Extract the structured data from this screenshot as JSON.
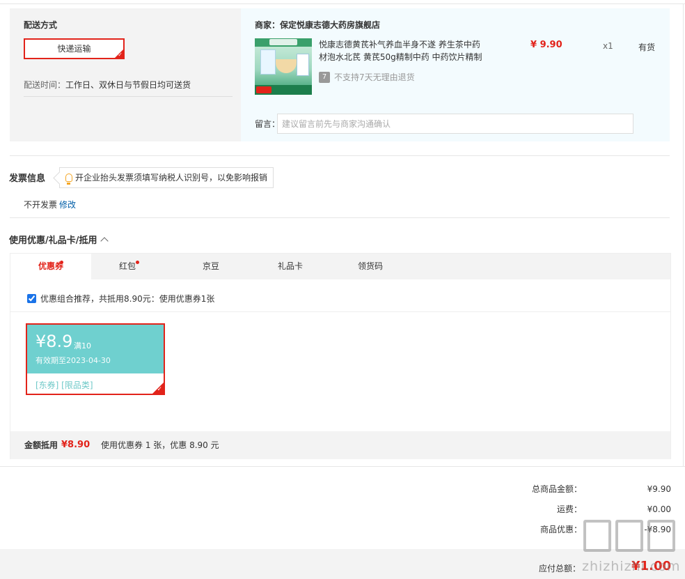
{
  "shipping": {
    "title": "配送方式",
    "method": "快递运输",
    "time_label": "配送时间：",
    "time_value": "工作日、双休日与节假日均可送货"
  },
  "seller": {
    "label": "商家：保定悦康志德大药房旗舰店",
    "product": {
      "name": "悦康志德黄芪补气养血半身不遂 养生茶中药材泡水北芪 黄芪50g精制中药 中药饮片精制",
      "price": "¥ 9.90",
      "qty": "x1",
      "stock": "有货",
      "return_policy": "不支持7天无理由退货",
      "return_icon_text": "7"
    },
    "remark_label": "留言：",
    "remark_placeholder": "建议留言前先与商家沟通确认"
  },
  "invoice": {
    "title": "发票信息",
    "tip": "开企业抬头发票须填写纳税人识别号，以免影响报销",
    "status": "不开发票",
    "edit": "修改"
  },
  "coupons": {
    "title": "使用优惠/礼品卡/抵用",
    "tabs": [
      {
        "label": "优惠券",
        "active": true,
        "dot": true
      },
      {
        "label": "红包",
        "active": false,
        "dot": true
      },
      {
        "label": "京豆",
        "active": false,
        "dot": false
      },
      {
        "label": "礼品卡",
        "active": false,
        "dot": false
      },
      {
        "label": "领货码",
        "active": false,
        "dot": false
      }
    ],
    "combo_text": "优惠组合推荐，共抵用8.90元：使用优惠券1张",
    "combo_checked": true,
    "card": {
      "amount": "¥8.9",
      "condition": "满10",
      "expiry": "有效期至2023-04-30",
      "tags": "[东券]  [限品类]",
      "color": "#6fd0cf"
    },
    "summary_label": "金额抵用",
    "summary_value": "¥8.90",
    "summary_desc": "使用优惠券 1 张，优惠 8.90 元"
  },
  "totals": {
    "goods_label": "总商品金额：",
    "goods_value": "¥9.90",
    "freight_label": "运费：",
    "freight_value": "¥0.00",
    "discount_label": "商品优惠：",
    "discount_value": "-¥8.90",
    "pay_label": "应付总额：",
    "pay_value": "¥1.00"
  },
  "watermark": {
    "text": "zhizhizhi.com"
  },
  "colors": {
    "accent": "#e2231a",
    "link": "#005ea7",
    "coupon": "#6fd0cf"
  }
}
